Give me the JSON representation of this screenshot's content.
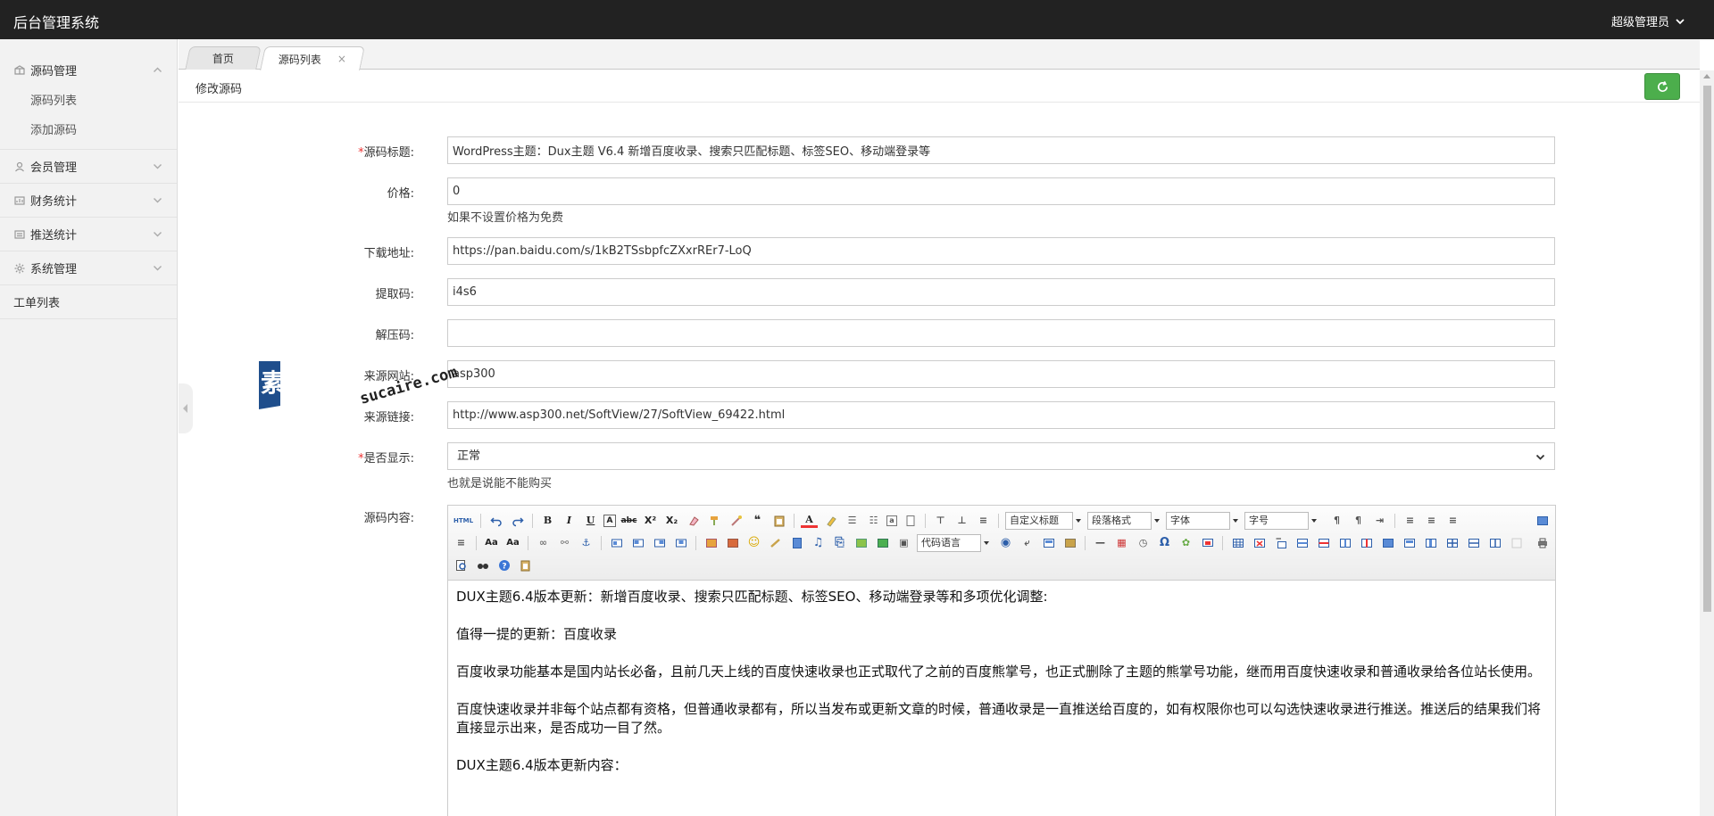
{
  "app": {
    "title": "后台管理系统",
    "user": "超级管理员"
  },
  "sidebar": {
    "groups": [
      {
        "label": "源码管理",
        "icon": "box-icon",
        "items": [
          "源码列表",
          "添加源码"
        ]
      },
      {
        "label": "会员管理",
        "icon": "user-icon"
      },
      {
        "label": "财务统计",
        "icon": "chart-icon"
      },
      {
        "label": "推送统计",
        "icon": "push-icon"
      },
      {
        "label": "系统管理",
        "icon": "gear-icon"
      },
      {
        "label": "工单列表"
      }
    ]
  },
  "tabs": [
    {
      "label": "首页"
    },
    {
      "label": "源码列表",
      "close": "×"
    }
  ],
  "page": {
    "title": "修改源码"
  },
  "form": {
    "title": {
      "label": "源码标题:",
      "value": "WordPress主题：Dux主题 V6.4 新增百度收录、搜索只匹配标题、标签SEO、移动端登录等"
    },
    "price": {
      "label": "价格:",
      "value": "0",
      "help": "如果不设置价格为免费"
    },
    "download": {
      "label": "下载地址:",
      "value": "https://pan.baidu.com/s/1kB2TSsbpfcZXxrREr7-LoQ"
    },
    "code": {
      "label": "提取码:",
      "value": "i4s6"
    },
    "unzip": {
      "label": "解压码:",
      "value": ""
    },
    "source_site": {
      "label": "来源网站:",
      "value": "asp300"
    },
    "source_link": {
      "label": "来源链接:",
      "value": "http://www.asp300.net/SoftView/27/SoftView_69422.html"
    },
    "display": {
      "label": "是否显示:",
      "value": "正常",
      "help": "也就是说能不能购买"
    },
    "content": {
      "label": "源码内容:"
    }
  },
  "editor": {
    "combos": {
      "heading": "自定义标题",
      "paragraph": "段落格式",
      "font": "字体",
      "size": "字号",
      "code_lang": "代码语言"
    },
    "html_btn": "HTML",
    "paragraphs": [
      "DUX主题6.4版本更新：新增百度收录、搜索只匹配标题、标签SEO、移动端登录等和多项优化调整:",
      "值得一提的更新：百度收录",
      "百度收录功能基本是国内站长必备，且前几天上线的百度快速收录也正式取代了之前的百度熊掌号，也正式删除了主题的熊掌号功能，继而用百度快速收录和普通收录给各位站长使用。",
      "百度快速收录并非每个站点都有资格，但普通收录都有，所以当发布或更新文章的时候，普通收录是一直推送给百度的，如有权限你也可以勾选快速收录进行推送。推送后的结果我们将直接显示出来，是否成功一目了然。",
      "DUX主题6.4版本更新内容："
    ]
  },
  "watermark": {
    "cn": "素材熟",
    "en": "sucaire.com"
  },
  "colors": {
    "topbar": "#222222",
    "accent_green": "#4cae4c",
    "required": "#e33333"
  }
}
